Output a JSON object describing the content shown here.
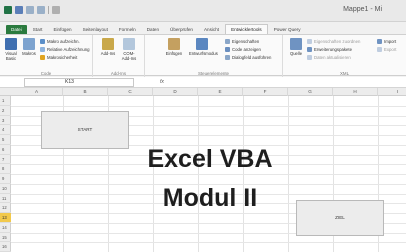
{
  "window": {
    "title": "Mappe1 - Mi"
  },
  "tabs": [
    "Datei",
    "Start",
    "Einfügen",
    "Seitenlayout",
    "Formeln",
    "Daten",
    "Überprüfen",
    "Ansicht",
    "Entwicklertools",
    "Power Query"
  ],
  "active_tab_index": 8,
  "ribbon": {
    "code_group": {
      "name": "Code",
      "visual_basic": "Visual Basic",
      "macros": "Makros",
      "record_macro": "Makro aufzeichn.",
      "relative_refs": "Relative Aufzeichnung",
      "macro_security": "Makrosicherheit"
    },
    "addins_group": {
      "name": "Add-Ins",
      "addins": "Add-Ins",
      "com_addins": "COM-Add-Ins"
    },
    "controls_group": {
      "name": "Steuerelemente",
      "insert": "Einfügen",
      "design_mode": "Entwurfsmodus",
      "properties": "Eigenschaften",
      "view_code": "Code anzeigen",
      "run_dialog": "Dialogfeld ausführen"
    },
    "xml_group": {
      "name": "XML",
      "source": "Quelle",
      "map_properties": "Eigenschaften zuordnen",
      "expansion_packs": "Erweiterungspakete",
      "refresh_data": "Daten aktualisieren",
      "import": "Import",
      "export": "Export"
    }
  },
  "formula_bar": {
    "name_box": "K13",
    "fx": "fx",
    "value": ""
  },
  "columns": [
    "A",
    "B",
    "C",
    "D",
    "E",
    "F",
    "G",
    "H",
    "I"
  ],
  "rows": [
    "1",
    "2",
    "3",
    "4",
    "5",
    "6",
    "7",
    "8",
    "9",
    "10",
    "11",
    "12",
    "13",
    "14",
    "15",
    "16"
  ],
  "selected_row": "13",
  "shapes": {
    "start_label": "START",
    "ziel_label": "ZIEL"
  },
  "headline": {
    "line1": "Excel VBA",
    "line2": "Modul II"
  },
  "colors": {
    "file_tab": "#2a7a3e",
    "selected_row": "#f2c94c"
  }
}
